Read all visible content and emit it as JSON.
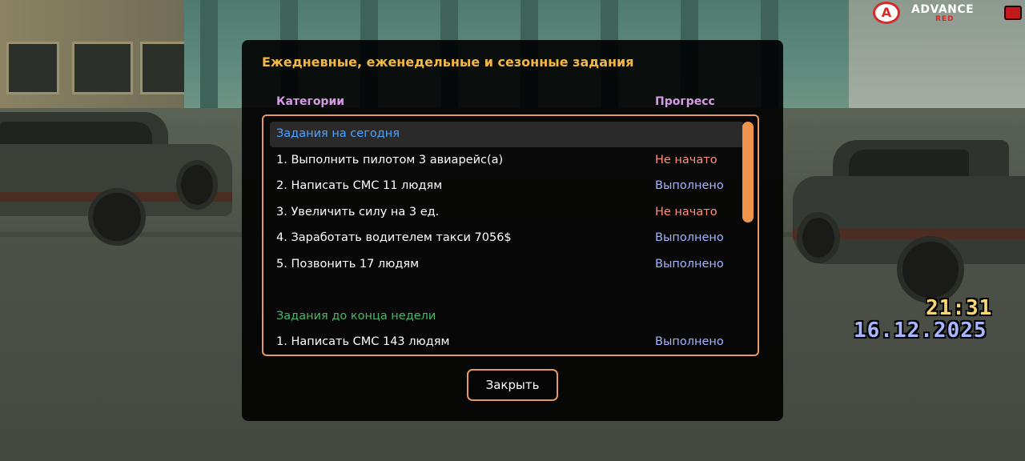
{
  "hud": {
    "logo_text": "ADVANCE",
    "logo_sub": "RED",
    "time": "21:31",
    "date": "16.12.2025"
  },
  "dialog": {
    "title": "Ежедневные, еженедельные и сезонные задания",
    "columns": {
      "category": "Категории",
      "progress": "Прогресс"
    },
    "sections": {
      "today": "Задания на сегодня",
      "week": "Задания до конца недели"
    },
    "today_tasks": [
      {
        "name": "1. Выполнить пилотом 3 авиарейс(а)",
        "status": "Не начато"
      },
      {
        "name": "2. Написать СМС 11 людям",
        "status": "Выполнено"
      },
      {
        "name": "3. Увеличить силу на 3 ед.",
        "status": "Не начато"
      },
      {
        "name": "4. Заработать водителем такси 7056$",
        "status": "Выполнено"
      },
      {
        "name": "5. Позвонить 17 людям",
        "status": "Выполнено"
      }
    ],
    "week_tasks": [
      {
        "name": "1. Написать СМС 143 людям",
        "status": "Выполнено"
      }
    ],
    "close_label": "Закрыть"
  },
  "colors": {
    "title": "#f2b844",
    "column_header": "#d69ae6",
    "section_today": "#4fa3ff",
    "section_week": "#48b86a",
    "status_not_started": "#ff8f7e",
    "status_done": "#a9b2ff",
    "accent_border": "#e59a62"
  },
  "icons": {
    "logo": "advance-red-logo-icon",
    "health": "health-icon"
  }
}
